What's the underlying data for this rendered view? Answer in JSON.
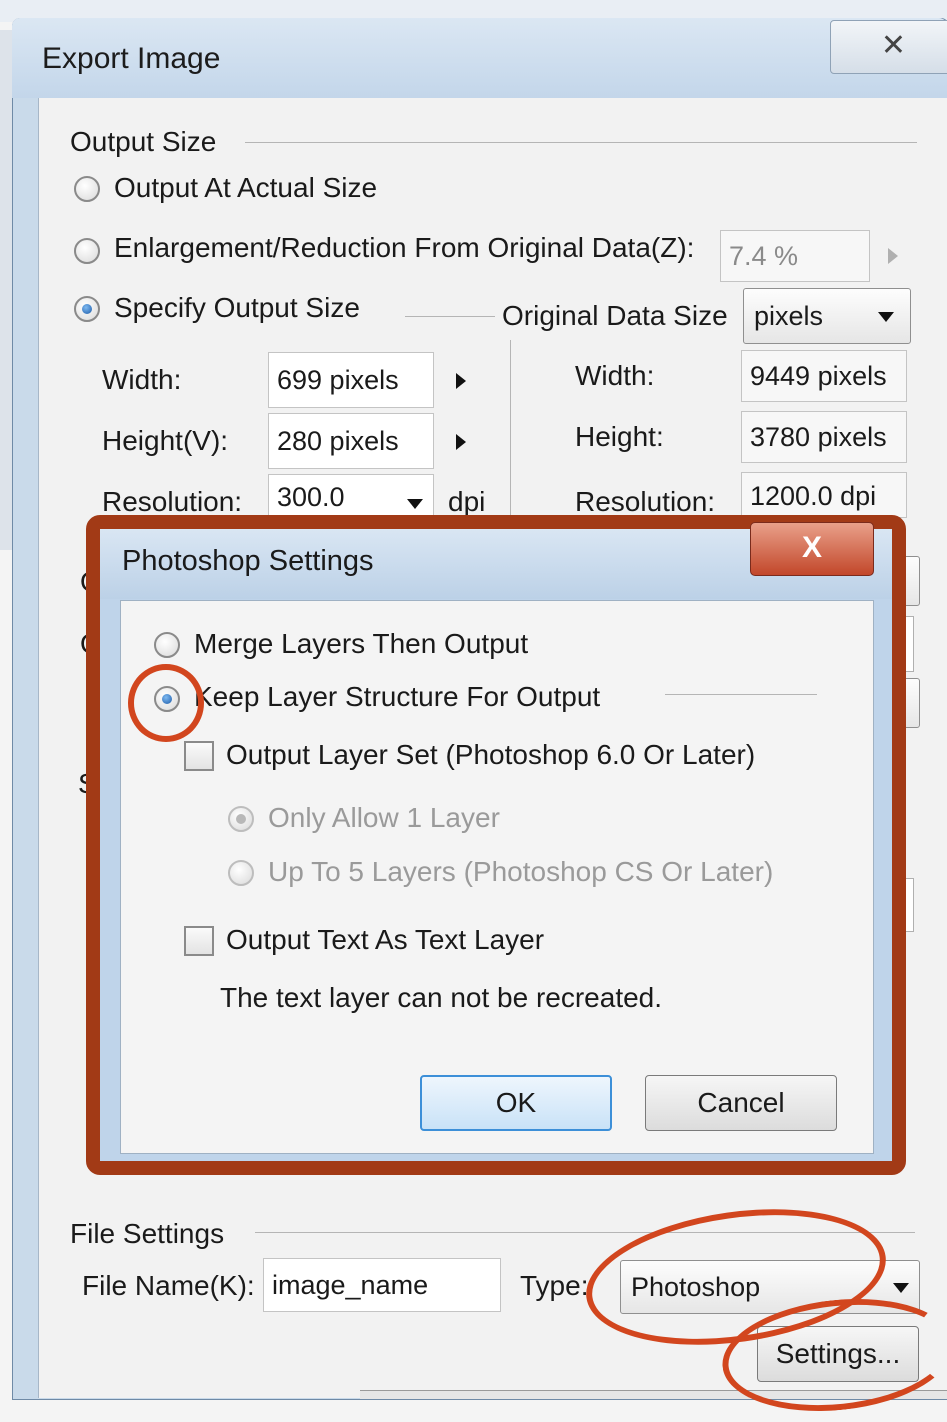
{
  "outer_dialog": {
    "title": "Export Image",
    "close_glyph": "✕",
    "output_size": {
      "group_label": "Output Size",
      "actual_size_label": "Output At Actual Size",
      "enlargement_label": "Enlargement/Reduction From Original Data(Z):",
      "enlargement_value": "7.4 %",
      "specify_label": "Specify Output Size",
      "selected": "specify",
      "width_label": "Width:",
      "width_value": "699 pixels",
      "height_label": "Height(V):",
      "height_value": "280 pixels",
      "resolution_label": "Resolution:",
      "resolution_value": "300.0",
      "resolution_unit": "dpi"
    },
    "original_data_size": {
      "label": "Original Data Size",
      "unit_value": "pixels",
      "width_label": "Width:",
      "width_value": "9449 pixels",
      "height_label": "Height:",
      "height_value": "3780 pixels",
      "resolution_label": "Resolution:",
      "resolution_value": "1200.0 dpi"
    },
    "peek_letters": {
      "o1": "O",
      "o2": "O",
      "s": "S"
    },
    "file_settings": {
      "group_label": "File Settings",
      "file_name_label": "File Name(K):",
      "file_name_value": "image_name",
      "type_label": "Type:",
      "type_value": "Photoshop",
      "settings_button": "Settings..."
    }
  },
  "photoshop_settings": {
    "title": "Photoshop Settings",
    "close_glyph": "X",
    "merge_layers_label": "Merge Layers Then Output",
    "keep_layer_label": "Keep Layer Structure For Output",
    "selected": "keep",
    "output_layer_set_label": "Output Layer Set (Photoshop 6.0 Or Later)",
    "output_layer_set_checked": false,
    "only_1_layer_label": "Only Allow 1 Layer",
    "up_to_5_label": "Up To 5 Layers (Photoshop CS Or Later)",
    "output_text_label": "Output Text As Text Layer",
    "output_text_checked": false,
    "note": "The text layer can not be recreated.",
    "ok_label": "OK",
    "cancel_label": "Cancel"
  },
  "colors": {
    "annotation_red": "#d2461e",
    "frame_red": "#a23a16",
    "title_blue": "#c3d6ea",
    "focus_blue": "#3c8fd8"
  }
}
